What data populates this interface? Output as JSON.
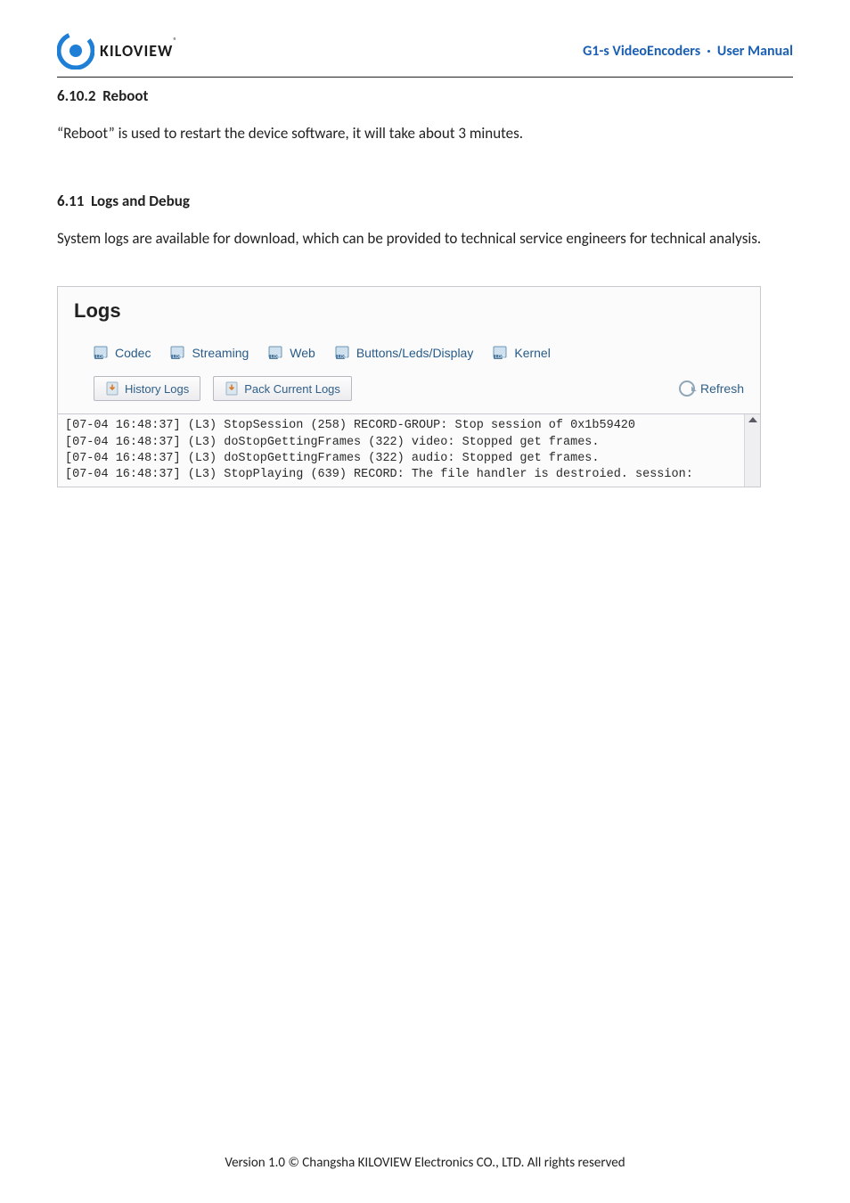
{
  "brand": {
    "name": "KILOVIEW",
    "reg": "®"
  },
  "header": {
    "product": "G1-s VideoEncoders",
    "sep": "·",
    "doc": "User Manual"
  },
  "sections": {
    "reboot": {
      "num": "6.10.2",
      "title": "Reboot",
      "body": "“Reboot” is used to restart the device software, it will take about 3 minutes."
    },
    "logs": {
      "num": "6.11",
      "title": "Logs and Debug",
      "body": "System logs are available for download, which can be provided to technical service engineers for technical analysis."
    }
  },
  "logs_panel": {
    "title": "Logs",
    "tabs": [
      "Codec",
      "Streaming",
      "Web",
      "Buttons/Leds/Display",
      "Kernel"
    ],
    "buttons": {
      "history": "History Logs",
      "pack": "Pack Current Logs"
    },
    "refresh": "Refresh",
    "lines": [
      "[07-04 16:48:37] (L3) StopSession (258) RECORD-GROUP: Stop session of 0x1b59420",
      "[07-04 16:48:37] (L3) doStopGettingFrames (322) video: Stopped get frames.",
      "[07-04 16:48:37] (L3) doStopGettingFrames (322) audio: Stopped get frames.",
      "[07-04 16:48:37] (L3) StopPlaying (639) RECORD: The file handler is destroied. session:"
    ]
  },
  "footer": "Version 1.0 © Changsha KILOVIEW Electronics CO., LTD. All rights reserved"
}
